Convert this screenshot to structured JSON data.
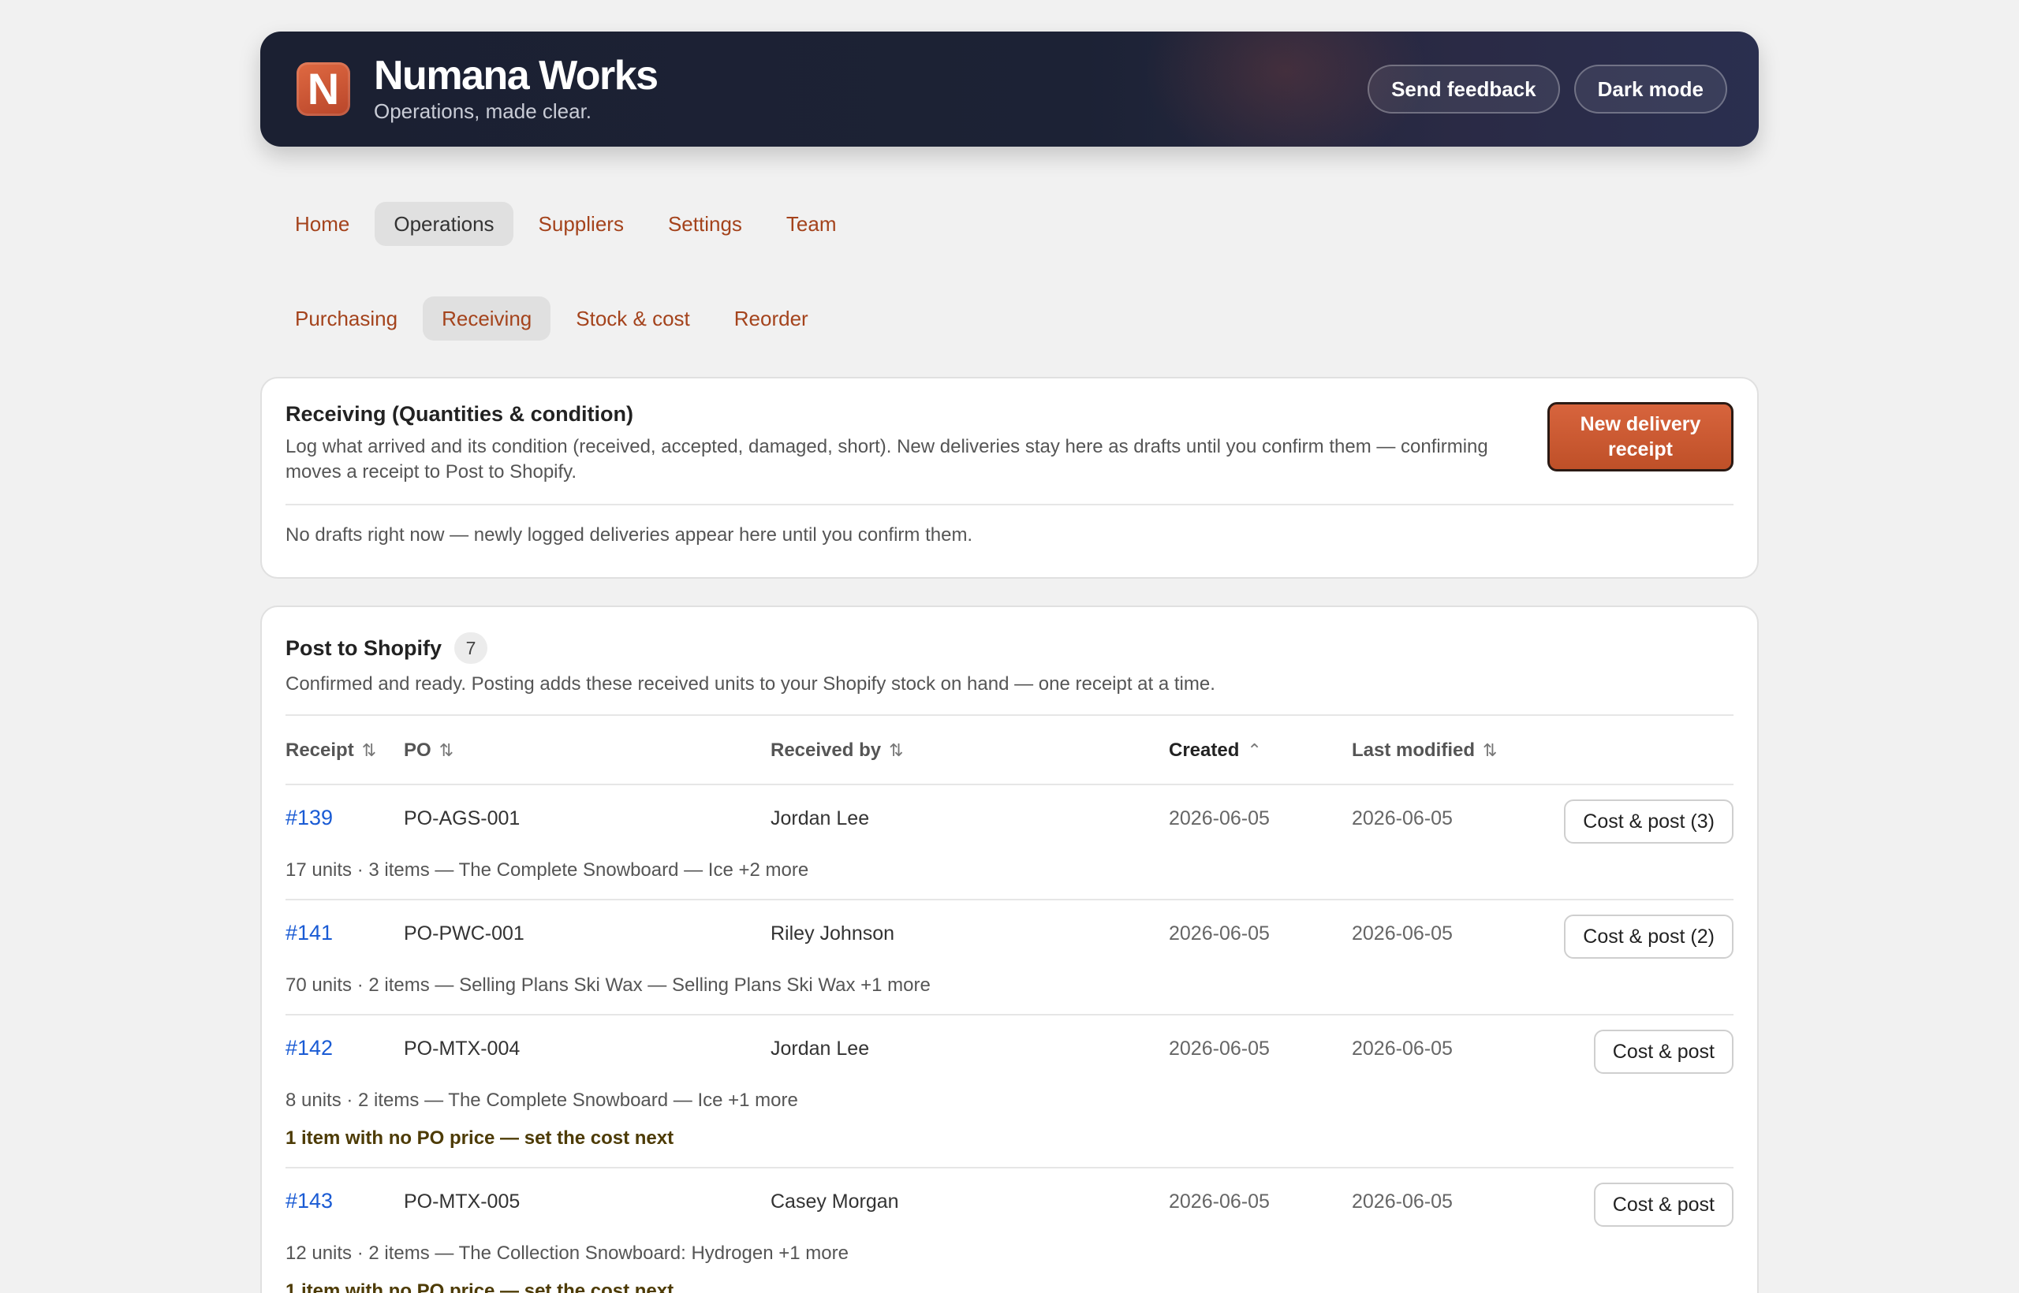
{
  "app": {
    "name": "Numana Works",
    "tagline": "Operations, made clear.",
    "logo_letter": "N",
    "send_feedback": "Send feedback",
    "dark_mode": "Dark mode"
  },
  "nav": {
    "items": [
      "Home",
      "Operations",
      "Suppliers",
      "Settings",
      "Team"
    ],
    "active": "Operations"
  },
  "subnav": {
    "items": [
      "Purchasing",
      "Receiving",
      "Stock & cost",
      "Reorder"
    ],
    "active": "Receiving"
  },
  "receiving": {
    "title": "Receiving (Quantities & condition)",
    "description": "Log what arrived and its condition (received, accepted, damaged, short). New deliveries stay here as drafts until you confirm them — confirming moves a receipt to Post to Shopify.",
    "new_button": "New delivery receipt",
    "empty": "No drafts right now — newly logged deliveries appear here until you confirm them."
  },
  "post": {
    "title": "Post to Shopify",
    "count": "7",
    "description": "Confirmed and ready. Posting adds these received units to your Shopify stock on hand — one receipt at a time.",
    "columns": {
      "receipt": "Receipt",
      "po": "PO",
      "received_by": "Received by",
      "created": "Created",
      "last_modified": "Last modified"
    },
    "rows": [
      {
        "receipt": "#139",
        "po": "PO-AGS-001",
        "received_by": "Jordan Lee",
        "created": "2026-06-05",
        "modified": "2026-06-05",
        "action": "Cost & post (3)",
        "meta": "17 units · 3 items — The Complete Snowboard — Ice +2 more",
        "warning": ""
      },
      {
        "receipt": "#141",
        "po": "PO-PWC-001",
        "received_by": "Riley Johnson",
        "created": "2026-06-05",
        "modified": "2026-06-05",
        "action": "Cost & post (2)",
        "meta": "70 units · 2 items — Selling Plans Ski Wax — Selling Plans Ski Wax +1 more",
        "warning": ""
      },
      {
        "receipt": "#142",
        "po": "PO-MTX-004",
        "received_by": "Jordan Lee",
        "created": "2026-06-05",
        "modified": "2026-06-05",
        "action": "Cost & post",
        "meta": "8 units · 2 items — The Complete Snowboard — Ice +1 more",
        "warning": "1 item with no PO price — set the cost next"
      },
      {
        "receipt": "#143",
        "po": "PO-MTX-005",
        "received_by": "Casey Morgan",
        "created": "2026-06-05",
        "modified": "2026-06-05",
        "action": "Cost & post",
        "meta": "12 units · 2 items — The Collection Snowboard: Hydrogen +1 more",
        "warning": "1 item with no PO price — set the cost next"
      }
    ]
  },
  "colors": {
    "accent": "#c4562d",
    "link": "#1a5bd4",
    "header_bg": "#1c2235",
    "nav_text": "#a4431c"
  },
  "icons": {
    "sort": "sort-updown-icon",
    "sort_active": "sort-asc-icon"
  }
}
